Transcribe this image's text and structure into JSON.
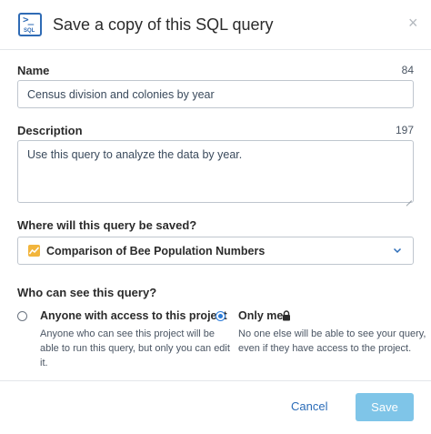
{
  "dialog": {
    "title": "Save a copy of this SQL query",
    "close_glyph": "×",
    "icon": "sql-icon",
    "icon_text": "SQL",
    "icon_prompt": ">_"
  },
  "name": {
    "label": "Name",
    "remaining": "84",
    "value": "Census division and colonies by year"
  },
  "description": {
    "label": "Description",
    "remaining": "197",
    "value": "Use this query to analyze the data by year."
  },
  "location": {
    "label": "Where will this query be saved?",
    "selected": "Comparison of Bee Population Numbers",
    "icon": "project-chart-icon",
    "icon_color": "#f2b53c"
  },
  "visibility": {
    "label": "Who can see this query?",
    "options": [
      {
        "title": "Anyone with access to this project",
        "desc_line1": "Anyone who can see this project will be",
        "desc_line2": "able to run this query, but only you can edit",
        "desc_line3": "it.",
        "selected": false
      },
      {
        "title": "Only me",
        "icon": "lock-icon",
        "desc_line1": "No one else will be able to see your query,",
        "desc_line2": "even if they have access to the project.",
        "selected": true
      }
    ]
  },
  "footer": {
    "cancel_label": "Cancel",
    "save_label": "Save"
  },
  "colors": {
    "accent": "#2b7bd8",
    "save_button": "#7fc5e8",
    "link": "#2b6cb8"
  }
}
